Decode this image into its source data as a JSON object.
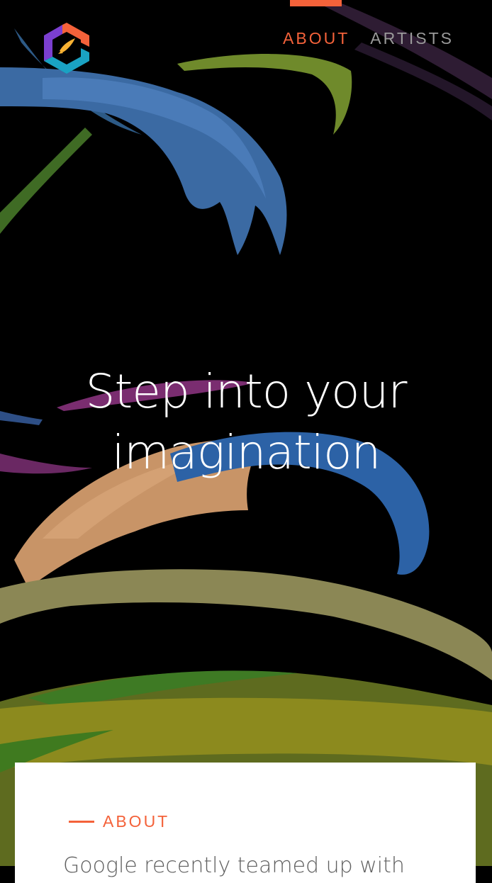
{
  "nav": {
    "items": [
      {
        "label": "ABOUT",
        "active": true
      },
      {
        "label": "ARTISTS",
        "active": false
      }
    ]
  },
  "logo": {
    "icon": "tilt-brush-logo-icon"
  },
  "hero": {
    "headline_line1": "Step into your",
    "headline_line2": "imagination"
  },
  "about": {
    "label": "ABOUT",
    "text": "Google recently teamed up with"
  },
  "colors": {
    "accent": "#f4623a",
    "nav_inactive": "#9a9a9a",
    "background": "#000000",
    "card": "#ffffff"
  }
}
